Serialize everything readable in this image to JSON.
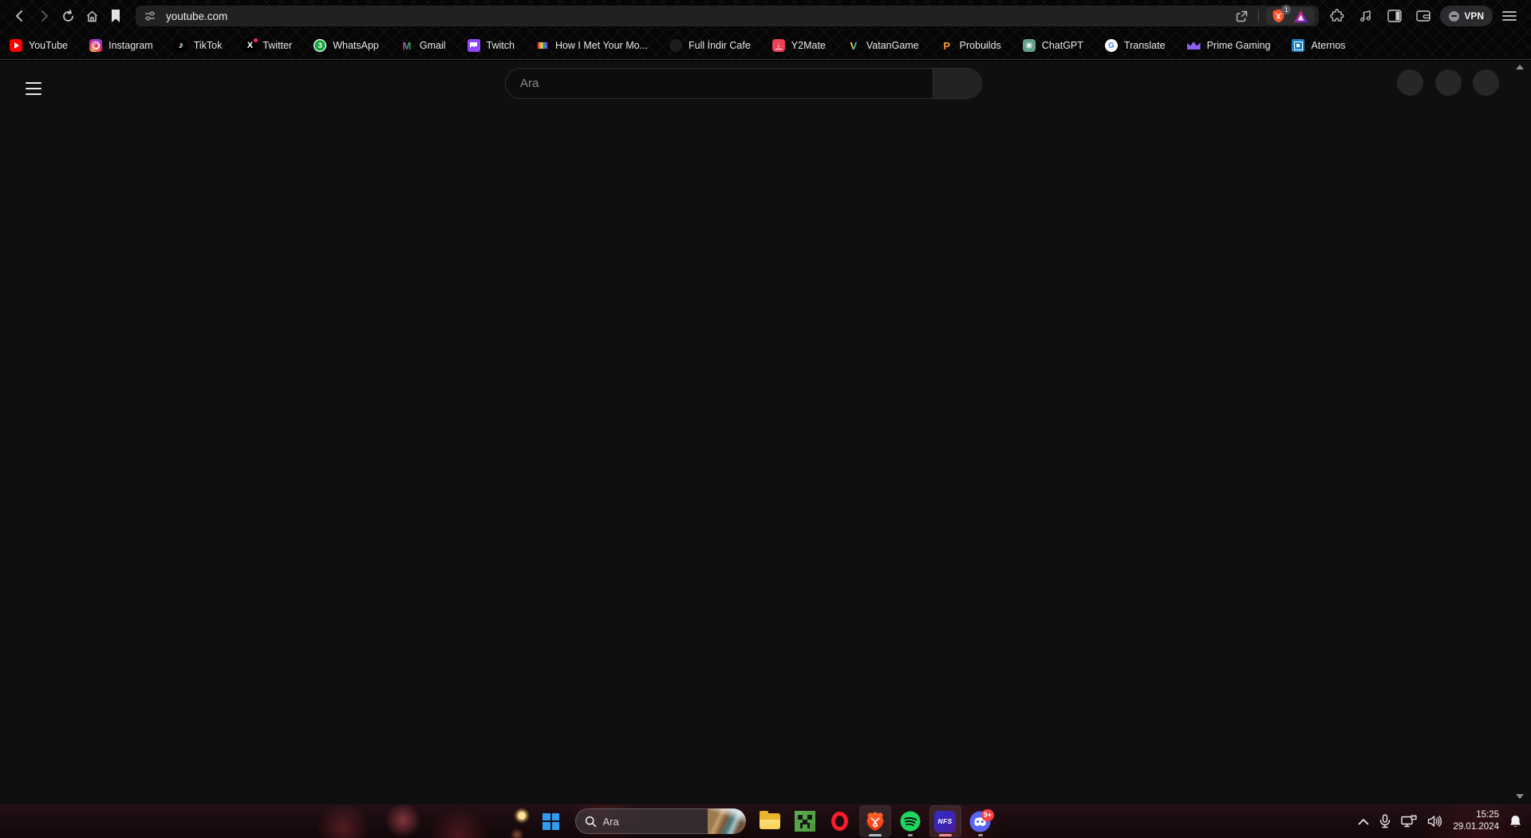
{
  "browser": {
    "toolbar": {
      "url": "youtube.com",
      "shield_badge": "1",
      "vpn_label": "VPN"
    },
    "bookmarks": [
      {
        "label": "YouTube",
        "icon": "youtube"
      },
      {
        "label": "Instagram",
        "icon": "instagram"
      },
      {
        "label": "TikTok",
        "icon": "tiktok"
      },
      {
        "label": "Twitter",
        "icon": "twitter"
      },
      {
        "label": "WhatsApp",
        "icon": "whatsapp",
        "badge": "3"
      },
      {
        "label": "Gmail",
        "icon": "gmail"
      },
      {
        "label": "Twitch",
        "icon": "twitch"
      },
      {
        "label": "How I Met Your Mo...",
        "icon": "tv"
      },
      {
        "label": "Full İndir Cafe",
        "icon": "generic"
      },
      {
        "label": "Y2Mate",
        "icon": "y2mate"
      },
      {
        "label": "VatanGame",
        "icon": "vatangame"
      },
      {
        "label": "Probuilds",
        "icon": "probuilds"
      },
      {
        "label": "ChatGPT",
        "icon": "chatgpt"
      },
      {
        "label": "Translate",
        "icon": "translate"
      },
      {
        "label": "Prime Gaming",
        "icon": "prime"
      },
      {
        "label": "Aternos",
        "icon": "aternos"
      }
    ]
  },
  "page": {
    "search_placeholder": "Ara"
  },
  "taskbar": {
    "search_placeholder": "Ara",
    "nfs_label": "NFS",
    "discord_badge": "9+",
    "tray": {
      "time": "15:25",
      "date": "29.01.2024"
    }
  },
  "colors": {
    "brave_orange": "#fb542b",
    "youtube_red": "#ff0000",
    "spotify_green": "#1ed760",
    "discord_blurple": "#5865f2",
    "page_bg": "#0f0f0f",
    "active_underline": "#a8bac4",
    "nfs_underline": "#ef8b95"
  }
}
